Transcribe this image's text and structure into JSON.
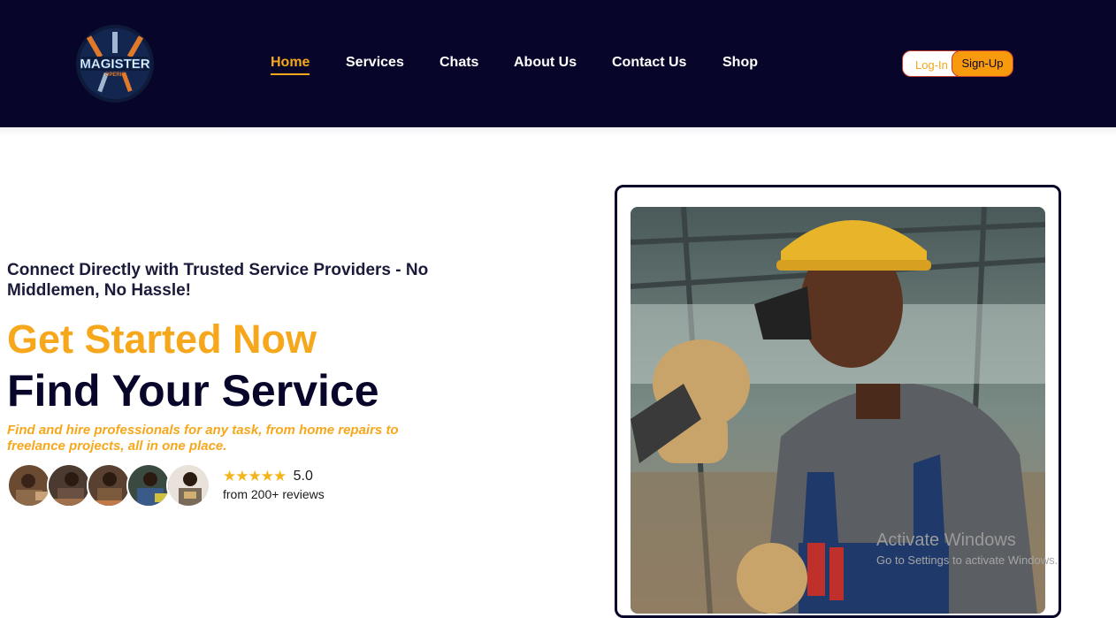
{
  "brand": {
    "logo_text": "MAGISTER",
    "logo_subtext": "OPERIS"
  },
  "nav": {
    "items": [
      {
        "label": "Home",
        "active": true
      },
      {
        "label": "Services",
        "active": false
      },
      {
        "label": "Chats",
        "active": false
      },
      {
        "label": "About Us",
        "active": false
      },
      {
        "label": "Contact Us",
        "active": false
      },
      {
        "label": "Shop",
        "active": false
      }
    ]
  },
  "auth": {
    "login_label": "Log-In",
    "signup_label": "Sign-Up"
  },
  "hero": {
    "tagline": "Connect Directly with Trusted Service Providers - No Middlemen, No Hassle!",
    "cta": "Get Started Now",
    "headline": "Find Your Service",
    "description": "Find and hire professionals for any task, from home repairs to freelance projects, all in one place.",
    "rating": {
      "stars": "★★★★★",
      "score": "5.0",
      "reviews": "from 200+ reviews"
    }
  },
  "colors": {
    "header_bg": "#07062a",
    "accent": "#f6a71c",
    "signup_bg": "#f89a0e"
  },
  "watermark": {
    "title": "Activate Windows",
    "subtitle": "Go to Settings to activate Windows."
  }
}
